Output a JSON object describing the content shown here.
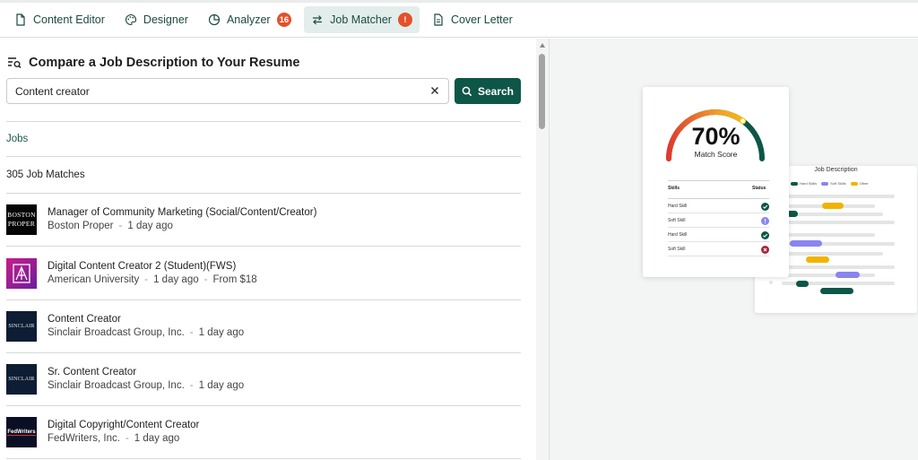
{
  "tabs": [
    {
      "label": "Content Editor",
      "icon": "document-icon",
      "active": false
    },
    {
      "label": "Designer",
      "icon": "palette-icon",
      "active": false
    },
    {
      "label": "Analyzer",
      "icon": "pie-chart-icon",
      "active": false,
      "badge": "16"
    },
    {
      "label": "Job Matcher",
      "icon": "swap-arrows-icon",
      "active": true,
      "badge": "!"
    },
    {
      "label": "Cover Letter",
      "icon": "document-lines-icon",
      "active": false
    }
  ],
  "matcher": {
    "heading": "Compare a Job Description to Your Resume",
    "search_value": "Content creator",
    "search_button": "Search",
    "jobs_link": "Jobs",
    "match_count": "305 Job Matches"
  },
  "jobs": [
    {
      "title": "Manager of Community Marketing (Social/Content/Creator)",
      "company": "Boston Proper",
      "posted": "1 day ago",
      "pay": "",
      "logo_text": "BOSTON PROPER"
    },
    {
      "title": "Digital Content Creator 2 (Student)(FWS)",
      "company": "American University",
      "posted": "1 day ago",
      "pay": "From $18",
      "logo_text": "AU"
    },
    {
      "title": "Content Creator",
      "company": "Sinclair Broadcast Group, Inc.",
      "posted": "1 day ago",
      "pay": "",
      "logo_text": "SINCLAIR"
    },
    {
      "title": "Sr. Content Creator",
      "company": "Sinclair Broadcast Group, Inc.",
      "posted": "1 day ago",
      "pay": "",
      "logo_text": "SINCLAIR"
    },
    {
      "title": "Digital Copyright/Content Creator",
      "company": "FedWriters, Inc.",
      "posted": "1 day ago",
      "pay": "",
      "logo_text": "FedWriters"
    }
  ],
  "illustration": {
    "score": "70%",
    "score_label": "Match Score",
    "match_fraction": 0.7,
    "skills_header": "Skills",
    "status_header": "Status",
    "skills": [
      {
        "name": "Hard Skill",
        "status": "check"
      },
      {
        "name": "Soft Skill",
        "status": "info"
      },
      {
        "name": "Hard Skill",
        "status": "check"
      },
      {
        "name": "Soft Skill",
        "status": "cross"
      }
    ],
    "jd_title": "Job Description",
    "legend": [
      "Hard Skills",
      "Soft Skills",
      "Other"
    ]
  },
  "colors": {
    "brand": "#0e5647",
    "badge": "#e5502a",
    "hard_skill": "#0e5647",
    "soft_skill": "#8a85ef",
    "other": "#f0b400",
    "cross": "#a3283e"
  }
}
